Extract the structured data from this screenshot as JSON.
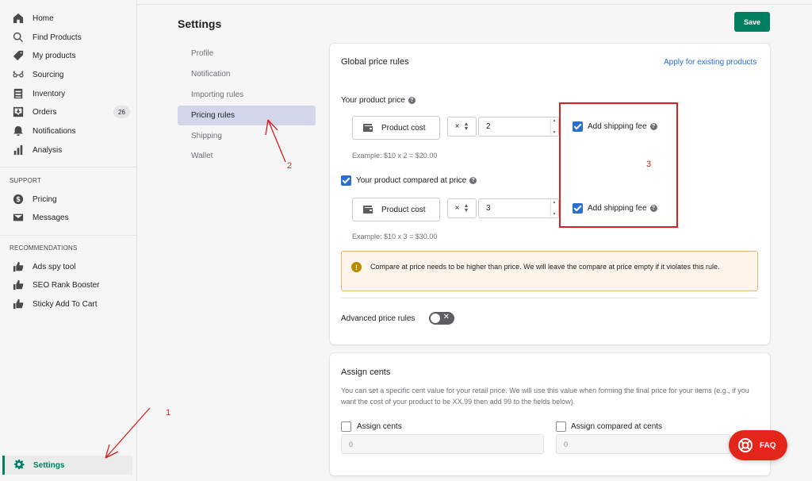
{
  "sidebar": {
    "main_items": [
      {
        "label": "Home",
        "icon": "home-icon"
      },
      {
        "label": "Find Products",
        "icon": "search-icon"
      },
      {
        "label": "My products",
        "icon": "tag-icon"
      },
      {
        "label": "Sourcing",
        "icon": "glasses-icon"
      },
      {
        "label": "Inventory",
        "icon": "inventory-icon"
      },
      {
        "label": "Orders",
        "icon": "orders-icon",
        "badge": "26"
      },
      {
        "label": "Notifications",
        "icon": "bell-icon"
      },
      {
        "label": "Analysis",
        "icon": "bar-chart-icon"
      }
    ],
    "support_title": "SUPPORT",
    "support_items": [
      {
        "label": "Pricing",
        "icon": "dollar-icon"
      },
      {
        "label": "Messages",
        "icon": "envelope-icon"
      }
    ],
    "recommendations_title": "RECOMMENDATIONS",
    "recommendation_items": [
      {
        "label": "Ads spy tool",
        "icon": "thumbs-up-icon"
      },
      {
        "label": "SEO Rank Booster",
        "icon": "thumbs-up-icon"
      },
      {
        "label": "Sticky Add To Cart",
        "icon": "thumbs-up-icon"
      }
    ],
    "settings_label": "Settings"
  },
  "header": {
    "title": "Settings",
    "save_label": "Save"
  },
  "subnav": {
    "items": [
      "Profile",
      "Notification",
      "Importing rules",
      "Pricing rules",
      "Shipping",
      "Wallet"
    ],
    "active": "Pricing rules"
  },
  "global_rules": {
    "title": "Global price rules",
    "apply_link": "Apply for existing products",
    "product_price_label": "Your product price",
    "product_cost_label": "Product cost",
    "operator": "×",
    "price_multiplier": "2",
    "add_shipping_label": "Add shipping fee",
    "example_price": "Example: $10 x 2 = $20.00",
    "compared_label": "Your product compared at price",
    "compared_multiplier": "3",
    "example_compared": "Example: $10 x 3 = $30.00",
    "warning_text": "Compare at price needs to be higher than price. We will leave the compare at price empty if it violates this rule.",
    "advanced_label": "Advanced price rules"
  },
  "assign_cents": {
    "title": "Assign cents",
    "description": "You can set a specific cent value for your retail price. We will use this value when forming the final price for your items (e.g., if you want the cost of your product to be XX.99 then add 99 to the fields below).",
    "assign_label": "Assign cents",
    "assign_value": "0",
    "compared_label": "Assign compared at cents",
    "compared_value": "0"
  },
  "faq_label": "FAQ",
  "annotations": [
    "1",
    "2",
    "3"
  ],
  "colors": {
    "primary": "#008060",
    "link": "#2c6ecb",
    "annotation": "#d81e1e",
    "faq": "#e4261a"
  }
}
